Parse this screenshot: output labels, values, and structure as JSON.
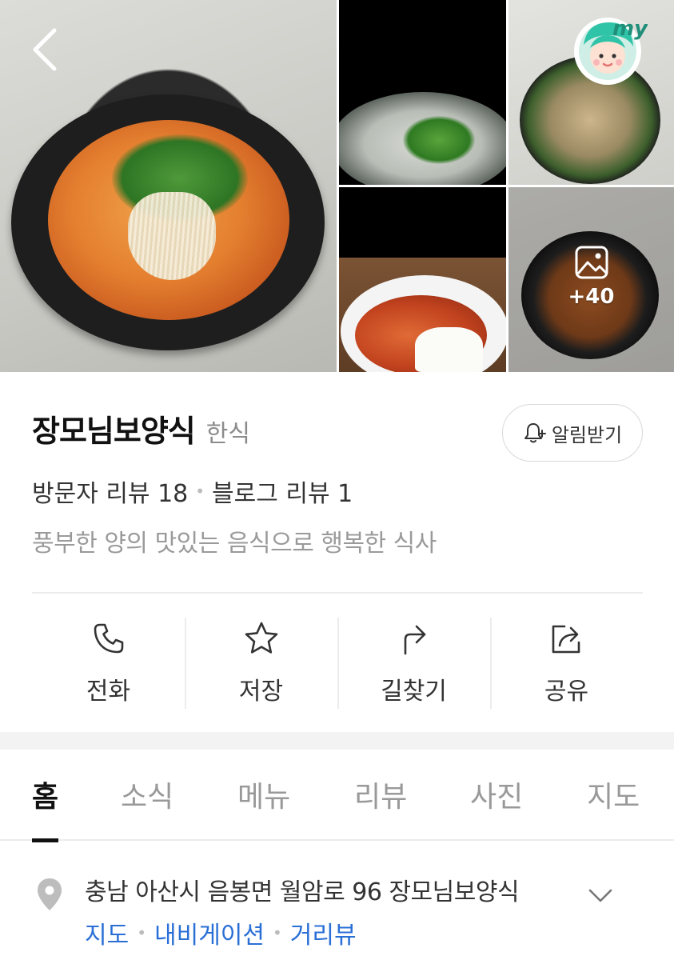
{
  "gallery": {
    "more_count": "+40"
  },
  "place": {
    "name": "장모님보양식",
    "category": "한식",
    "alarm_label": "알림받기",
    "visitor_reviews": "방문자 리뷰 18",
    "blog_reviews": "블로그 리뷰 1",
    "description": "풍부한 양의 맛있는 음식으로 행복한 식사"
  },
  "actions": {
    "call": "전화",
    "save": "저장",
    "directions": "길찾기",
    "share": "공유"
  },
  "tabs": [
    {
      "label": "홈",
      "active": true
    },
    {
      "label": "소식"
    },
    {
      "label": "메뉴"
    },
    {
      "label": "리뷰"
    },
    {
      "label": "사진"
    },
    {
      "label": "지도"
    }
  ],
  "address": {
    "text": "충남 아산시 음봉면 월암로 96 장모님보양식",
    "links": [
      "지도",
      "내비게이션",
      "거리뷰"
    ]
  },
  "icons": {
    "back": "chevron-left-icon",
    "my": "my-avatar-icon",
    "alarm": "bell-plus-icon",
    "call": "phone-icon",
    "save": "star-icon",
    "directions": "turn-arrow-icon",
    "share": "share-icon",
    "pin": "location-pin-icon",
    "expand": "chevron-down-icon",
    "photos": "image-icon"
  },
  "colors": {
    "link": "#2a6fd6",
    "text": "#222222",
    "muted": "#9a9a9a"
  }
}
